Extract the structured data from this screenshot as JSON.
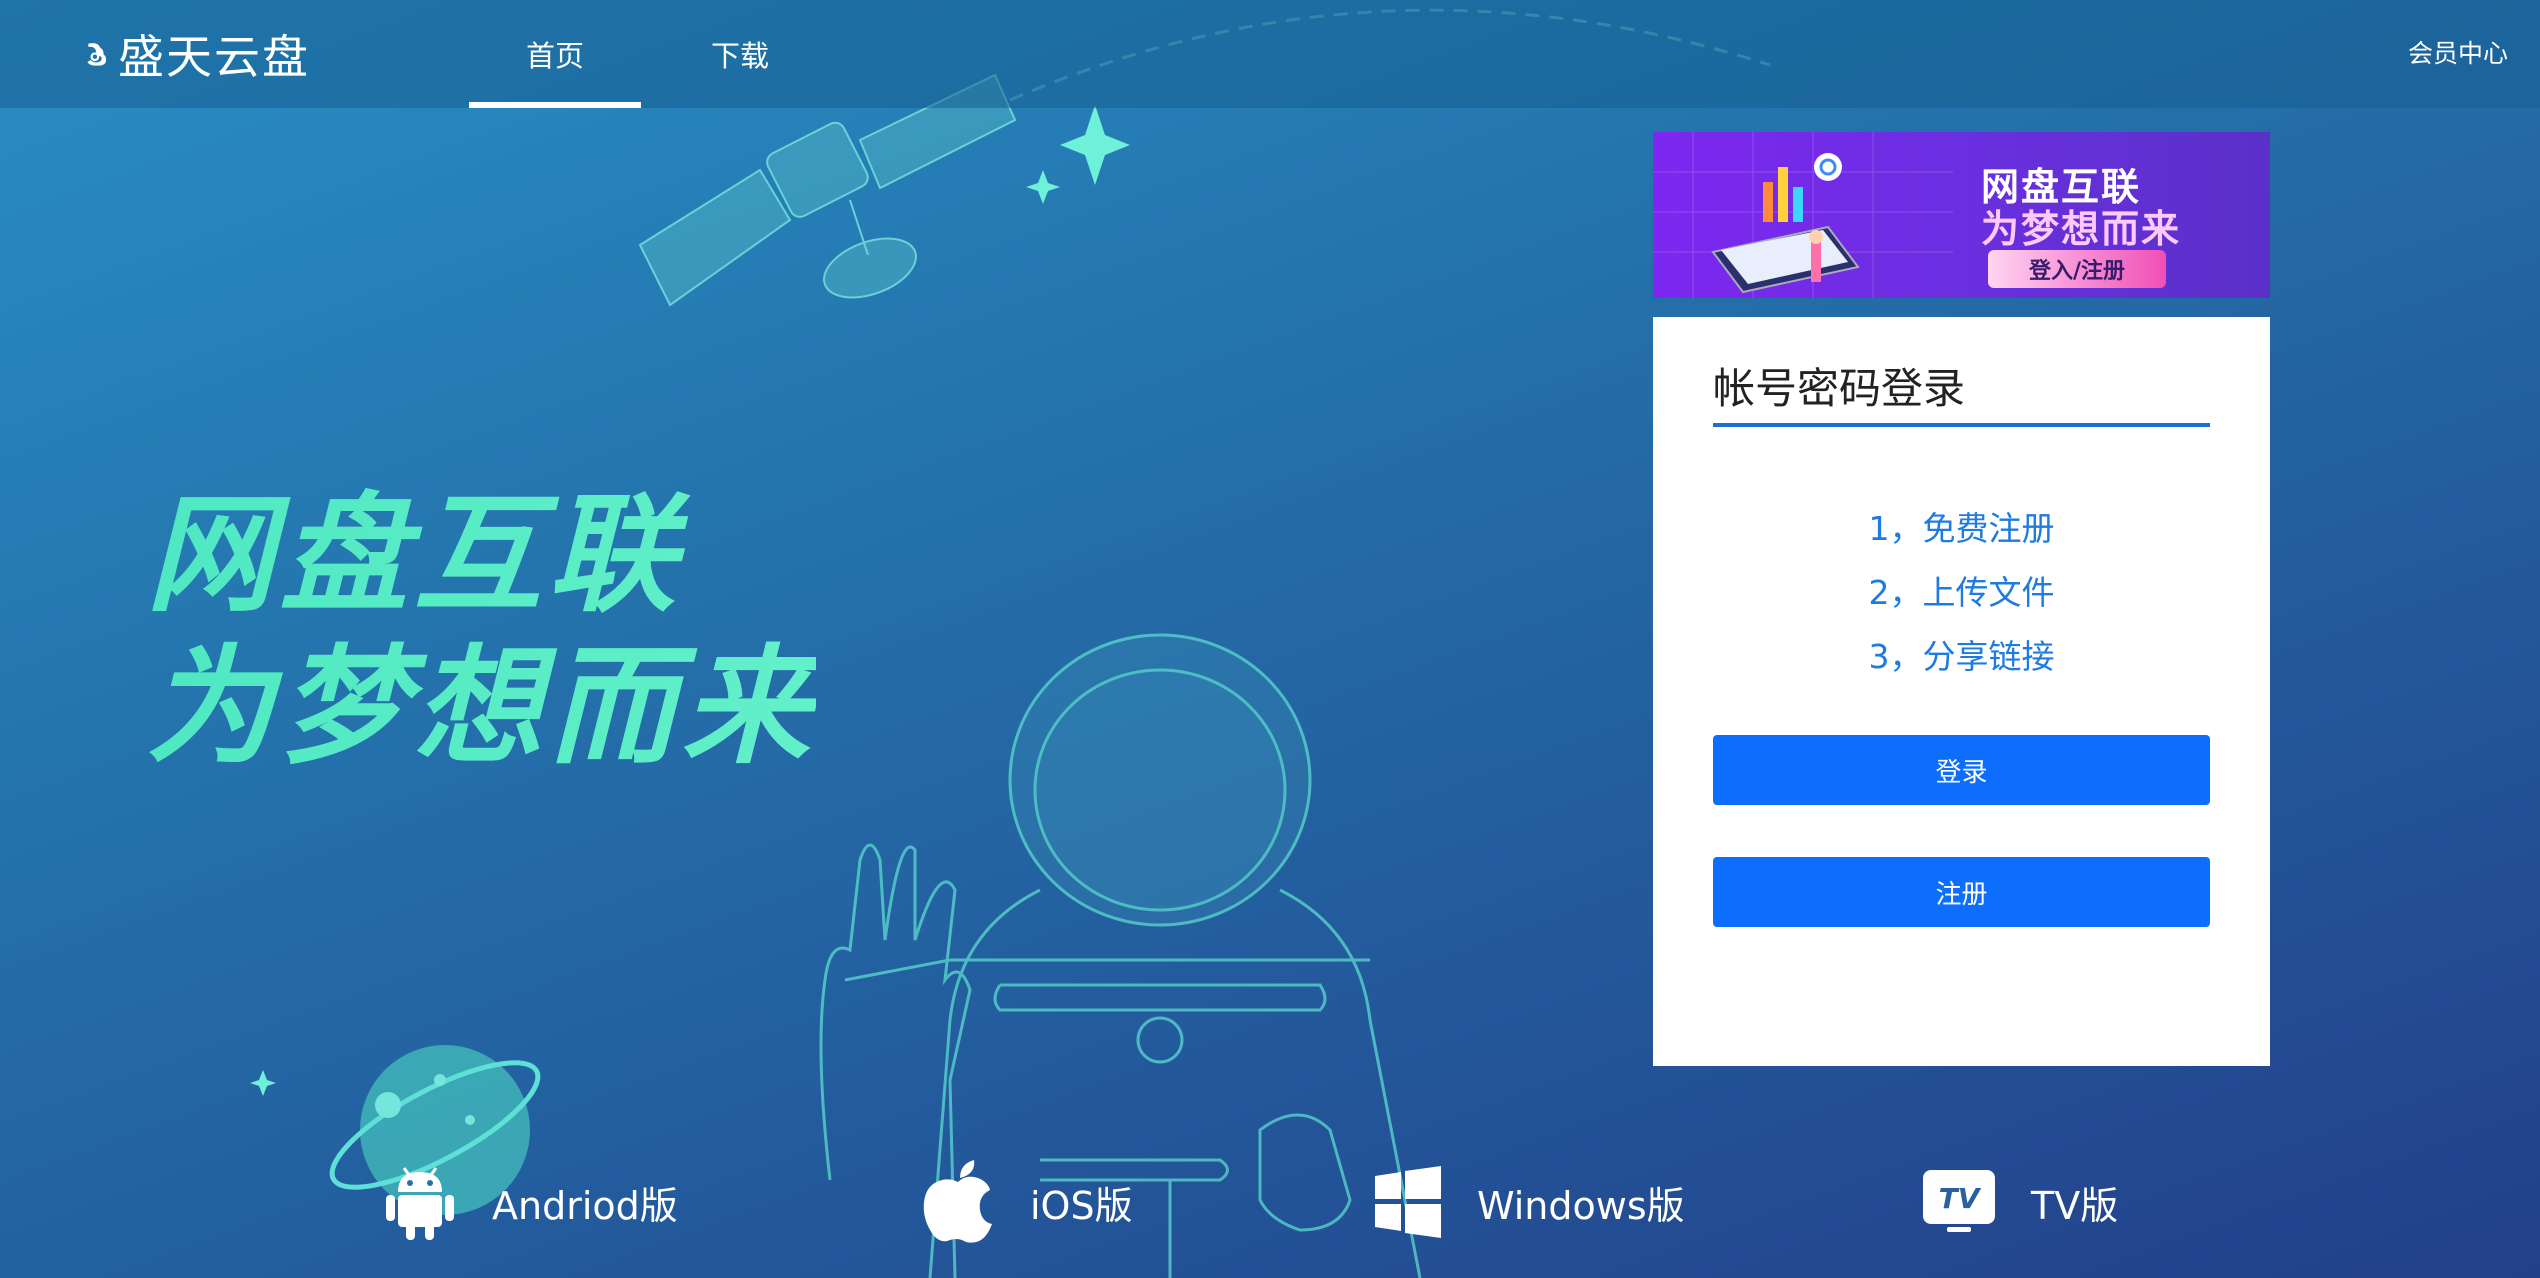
{
  "header": {
    "logo_text": "盛天云盘",
    "nav": [
      {
        "label": "首页",
        "active": true
      },
      {
        "label": "下载",
        "active": false
      }
    ],
    "member_center": "会员中心"
  },
  "hero": {
    "line1": "网盘互联",
    "line2": "为梦想而来"
  },
  "banner": {
    "line1": "网盘互联",
    "line2": "为梦想而来",
    "button": "登入/注册"
  },
  "login_card": {
    "title": "帐号密码登录",
    "steps": [
      "1，免费注册",
      "2，上传文件",
      "3，分享链接"
    ],
    "login_button": "登录",
    "register_button": "注册"
  },
  "downloads": [
    {
      "icon": "android-icon",
      "label": "Andriod版"
    },
    {
      "icon": "apple-icon",
      "label": "iOS版"
    },
    {
      "icon": "windows-icon",
      "label": "Windows版"
    },
    {
      "icon": "tv-icon",
      "label": "TV版"
    }
  ],
  "colors": {
    "accent": "#0d6efd",
    "hero_text": "#55ecc6",
    "step_text": "#1f7be0"
  }
}
